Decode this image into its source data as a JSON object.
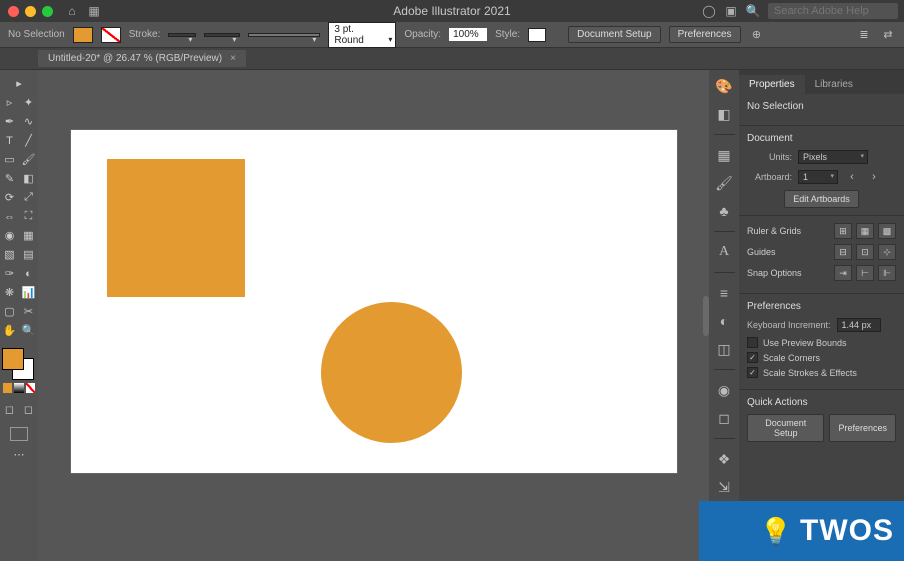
{
  "app": {
    "title": "Adobe Illustrator 2021",
    "search_placeholder": "Search Adobe Help"
  },
  "controlbar": {
    "selection_status": "No Selection",
    "stroke_label": "Stroke:",
    "stroke_weight": "",
    "stroke_profile": "",
    "brush_def": "",
    "stroke_style": "3 pt. Round",
    "opacity_label": "Opacity:",
    "opacity_value": "100%",
    "style_label": "Style:",
    "doc_setup_label": "Document Setup",
    "preferences_label": "Preferences"
  },
  "document": {
    "tab_title": "Untitled-20* @ 26.47 % (RGB/Preview)"
  },
  "shapes": {
    "rect_color": "#e39b31",
    "circle_color": "#e39b31"
  },
  "panels": {
    "tab_properties": "Properties",
    "tab_libraries": "Libraries",
    "no_selection": "No Selection",
    "document_heading": "Document",
    "units_label": "Units:",
    "units_value": "Pixels",
    "artboard_label": "Artboard:",
    "artboard_value": "1",
    "edit_artboards": "Edit Artboards",
    "ruler_grids": "Ruler & Grids",
    "guides": "Guides",
    "snap_options": "Snap Options",
    "preferences_heading": "Preferences",
    "kb_inc_label": "Keyboard Increment:",
    "kb_inc_value": "1.44 px",
    "use_preview_bounds": "Use Preview Bounds",
    "scale_corners": "Scale Corners",
    "scale_strokes": "Scale Strokes & Effects",
    "quick_actions": "Quick Actions",
    "qa_doc_setup": "Document Setup",
    "qa_preferences": "Preferences"
  },
  "watermark": {
    "text": "TWOS"
  }
}
